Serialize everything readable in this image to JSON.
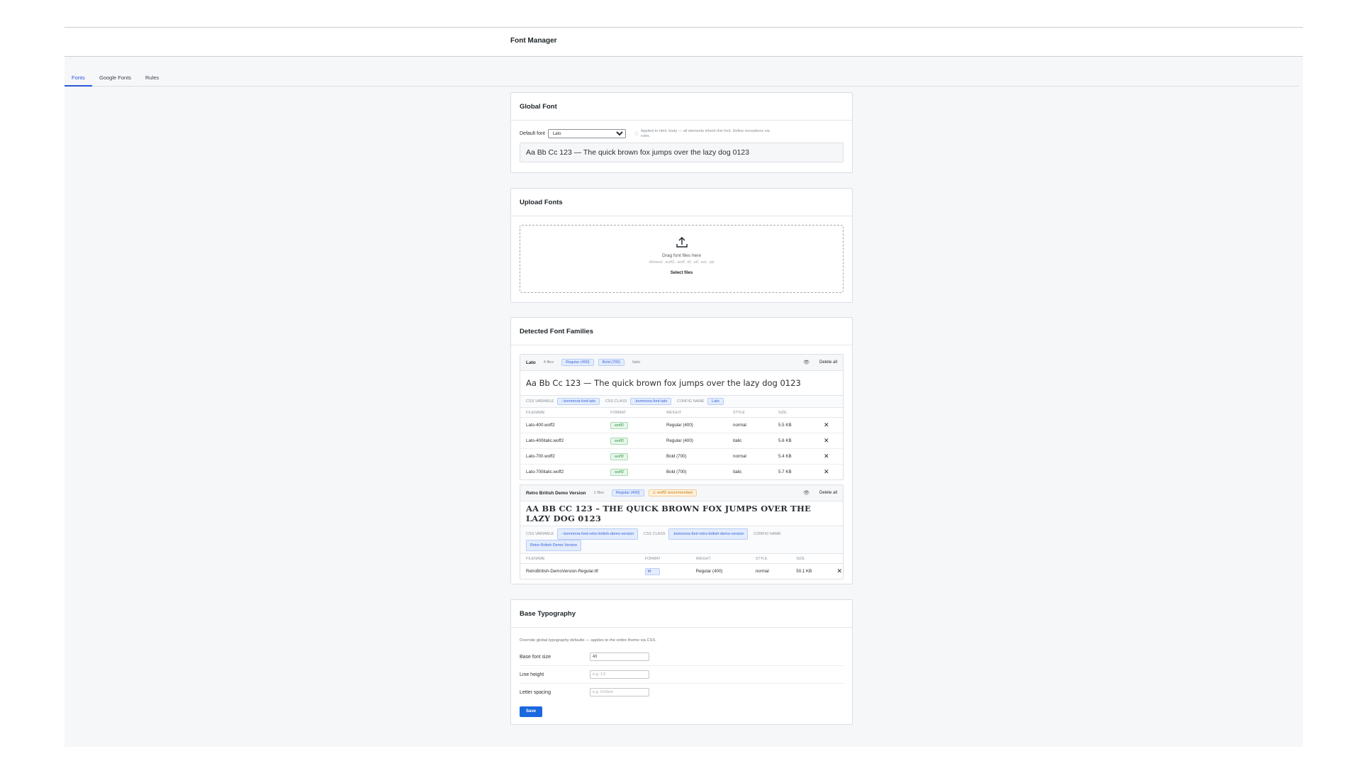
{
  "header": {
    "title": "Font Manager"
  },
  "tabs": [
    {
      "label": "Fonts",
      "active": true
    },
    {
      "label": "Google Fonts",
      "active": false
    },
    {
      "label": "Rules",
      "active": false
    }
  ],
  "global_font": {
    "title": "Global Font",
    "default_label": "Default font",
    "selected": "Lato",
    "help": "Applied to html, body — all elements inherit this font. Define exceptions via rules.",
    "preview": "Aa Bb Cc 123 — The quick brown fox jumps over the lazy dog 0123"
  },
  "upload": {
    "title": "Upload Fonts",
    "drag_text": "Drag font files here",
    "allowed": "Allowed: .woff2, .woff, .ttf, .otf, .eot, .zip",
    "select_label": "Select files"
  },
  "detected": {
    "title": "Detected Font Families",
    "delete_all": "Delete all",
    "columns": [
      "FILENAME",
      "FORMAT",
      "WEIGHT",
      "STYLE",
      "SIZE"
    ],
    "css_variable_label": "CSS VARIABLE",
    "css_class_label": "CSS CLASS",
    "config_name_label": "CONFIG NAME",
    "families": [
      {
        "name": "Lato",
        "file_count": "4 files",
        "badges": [
          "Regular (400)",
          "Bold (700)"
        ],
        "extra": "Italic",
        "preview": "Aa Bb Cc 123 — The quick brown fox jumps over the lazy dog 0123",
        "css_variable": "--kommora-font-lato",
        "css_class": ".kommora-font-lato",
        "config_name": "Lato",
        "files": [
          {
            "filename": "Lato-400.woff2",
            "format": "woff2",
            "weight": "Regular (400)",
            "style": "normal",
            "size": "5.5 KB"
          },
          {
            "filename": "Lato-400italic.woff2",
            "format": "woff2",
            "weight": "Regular (400)",
            "style": "italic",
            "size": "5.6 KB"
          },
          {
            "filename": "Lato-700.woff2",
            "format": "woff2",
            "weight": "Bold (700)",
            "style": "normal",
            "size": "5.4 KB"
          },
          {
            "filename": "Lato-700italic.woff2",
            "format": "woff2",
            "weight": "Bold (700)",
            "style": "italic",
            "size": "5.7 KB"
          }
        ]
      },
      {
        "name": "Retro British Demo Version",
        "file_count": "1 files",
        "badges": [
          "Regular (400)"
        ],
        "warning": "⚠ woff2 recommended",
        "preview": "AA BB CC 123 – THE QUICK BROWN FOX JUMPS OVER THE LAZY DOG 0123",
        "css_variable": "--kommora-font-retro-british-demo-version",
        "css_class": ".kommora-font-retro-british-demo-version",
        "config_name": "Retro British Demo Version",
        "files": [
          {
            "filename": "RetroBritish-DemoVersion-Regular.ttf",
            "format": "ttf",
            "weight": "Regular (400)",
            "style": "normal",
            "size": "50.1 KB"
          }
        ]
      }
    ]
  },
  "base_typography": {
    "title": "Base Typography",
    "description": "Override global typography defaults — applies to the entire theme via CSS.",
    "fields": [
      {
        "label": "Base font size",
        "value": "43",
        "placeholder": ""
      },
      {
        "label": "Line height",
        "value": "",
        "placeholder": "e.g. 1.5"
      },
      {
        "label": "Letter spacing",
        "value": "",
        "placeholder": "e.g. 0.02em"
      }
    ],
    "save_label": "Save"
  },
  "icons": {
    "upload": "upload-icon",
    "view": "eye-icon",
    "remove": "close-icon",
    "dropdown": "chevron-down-icon"
  },
  "colors": {
    "accent": "#2c57d9",
    "primary_button": "#1a67e0",
    "warning": "#c27a14",
    "success": "#2f9a47"
  }
}
